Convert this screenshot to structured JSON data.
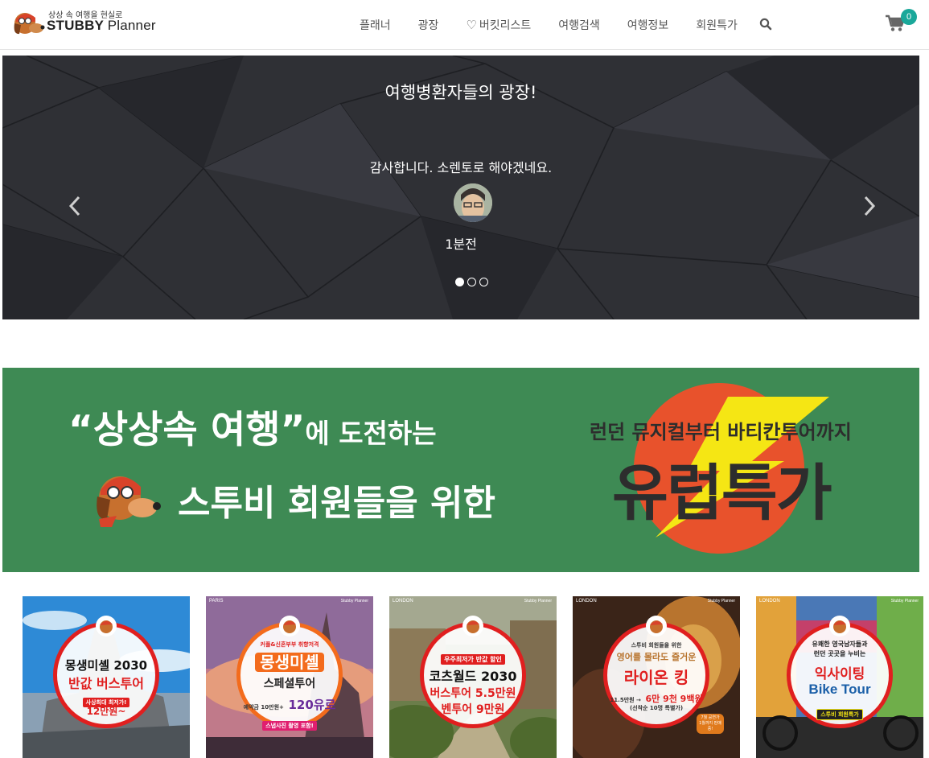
{
  "header": {
    "logo_tagline": "상상 속 여행을 현실로",
    "logo_name": "STUBBY",
    "logo_name_thin": "Planner",
    "nav": [
      "플래너",
      "광장",
      "버킷리스트",
      "여행검색",
      "여행정보",
      "회원특가"
    ],
    "cart_count": "0",
    "colors": {
      "accent": "#1aa89a"
    }
  },
  "hero": {
    "title": "여행병환자들의 광장!",
    "quote": "감사합니다. 소렌토로 해야겠네요.",
    "time": "1분전",
    "slides": 3,
    "active_slide": 1
  },
  "promo": {
    "line1_quote": "“상상속 여행”",
    "line1_rest": "에 도전하는",
    "line2": "스투비 회원들을 위한",
    "sub": "런던 뮤지컬부터 바티칸투어까지",
    "big": "유럽특가",
    "colors": {
      "bg": "#3e8a54",
      "circle": "#e8522c",
      "bolt": "#f5e614"
    }
  },
  "tiles": [
    {
      "loc": "",
      "brand": "",
      "lines": [
        "몽생미셸 2030",
        "반값 버스투어",
        "사상최대 최저가!",
        "12만원~"
      ]
    },
    {
      "loc": "PARIS",
      "brand": "Stubby Planner",
      "lines": [
        "커플&신혼부부 취향저격",
        "몽생미셸",
        "스페셜투어",
        "예약금 10만원+",
        "120유로",
        "스냅사진 촬영 포함!"
      ]
    },
    {
      "loc": "LONDON",
      "brand": "Stubby Planner",
      "lines": [
        "우주최저가 반값 할인",
        "코츠월드 2030",
        "버스투어 5.5만원",
        "벤투어 9만원"
      ]
    },
    {
      "loc": "LONDON",
      "brand": "Stubby Planner",
      "lines": [
        "스투비 회원들을 위한",
        "영어를 몰라도 즐거운",
        "라이온 킹",
        "11.5만원 →",
        "6만 9천 9백원",
        "(선착순 10명 특별가)",
        "7월 공연가",
        "1월까지 판매 중!"
      ]
    },
    {
      "loc": "LONDON",
      "brand": "Stubby Planner",
      "lines": [
        "유쾌한 영국남자들과",
        "런던 곳곳을 누비는",
        "익사이팅",
        "Bike Tour",
        "스투비 회원특가"
      ]
    }
  ]
}
